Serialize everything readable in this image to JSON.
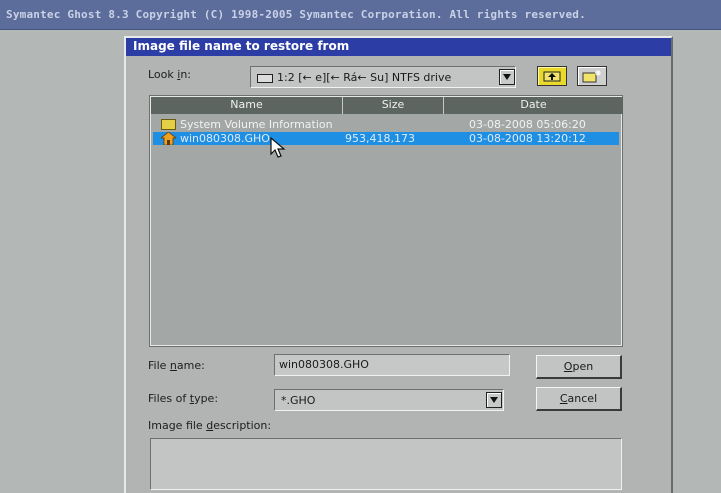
{
  "topbar": {
    "title": "Symantec Ghost 8.3   Copyright (C) 1998-2005 Symantec Corporation. All rights reserved."
  },
  "dialog": {
    "title": "Image file name to restore from",
    "look_in": {
      "label_prefix": "Look ",
      "label_key": "i",
      "label_suffix": "n:",
      "value": "1:2 [← e][← Rá← Su] NTFS drive"
    },
    "columns": [
      "Name",
      "Size",
      "Date"
    ],
    "rows": [
      {
        "name": "System Volume Information",
        "size": "",
        "date": "03-08-2008 05:06:20",
        "type": "folder",
        "selected": false
      },
      {
        "name": "win080308.GHO",
        "size": "953,418,173",
        "date": "03-08-2008 13:20:12",
        "type": "ghost-image",
        "selected": true
      }
    ],
    "file_name": {
      "label_prefix": "File ",
      "label_key": "n",
      "label_suffix": "ame:",
      "value": "win080308.GHO"
    },
    "file_type": {
      "label_prefix": "Files of ",
      "label_key": "t",
      "label_suffix": "ype:",
      "value": "*.GHO"
    },
    "description": {
      "label_prefix": "Image file ",
      "label_key": "d",
      "label_suffix": "escription:"
    },
    "buttons": {
      "open_key": "O",
      "open_rest": "pen",
      "cancel_key": "C",
      "cancel_rest": "ancel"
    }
  },
  "icons": {
    "up_folder": "up-folder-icon",
    "new_folder": "new-folder-icon",
    "dropdown": "chevron-down-icon",
    "drive": "drive-icon",
    "folder": "folder-icon",
    "ghost_image": "ghost-image-icon",
    "cursor": "mouse-pointer-icon"
  },
  "colors": {
    "title_bar": "#2d3da6",
    "selection": "#1e8fe3",
    "list_background": "#a3a7a6",
    "header_background": "#5d6561",
    "folder_yellow": "#e5cf44",
    "toolbar_yellow": "#e8d92a"
  }
}
